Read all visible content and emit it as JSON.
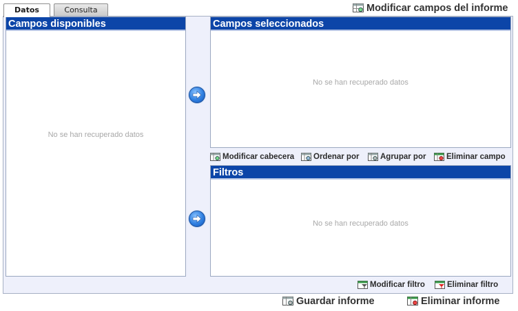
{
  "tabs": [
    {
      "label": "Datos",
      "active": true
    },
    {
      "label": "Consulta",
      "active": false
    }
  ],
  "top_action": {
    "label": "Modificar campos del informe",
    "icon": "table-edit-icon"
  },
  "available_fields": {
    "title": "Campos disponibles",
    "empty_text": "No se han recuperado datos"
  },
  "selected_fields": {
    "title": "Campos seleccionados",
    "empty_text": "No se han recuperado datos",
    "actions": [
      {
        "label": "Modificar cabecera",
        "icon": "table-edit-icon"
      },
      {
        "label": "Ordenar por",
        "icon": "table-sort-icon"
      },
      {
        "label": "Agrupar por",
        "icon": "table-group-icon"
      },
      {
        "label": "Eliminar campo",
        "icon": "table-delete-icon"
      }
    ]
  },
  "filters": {
    "title": "Filtros",
    "empty_text": "No se han recuperado datos",
    "actions": [
      {
        "label": "Modificar filtro",
        "icon": "filter-edit-icon"
      },
      {
        "label": "Eliminar filtro",
        "icon": "filter-delete-icon"
      }
    ]
  },
  "bottom_actions": [
    {
      "label": "Guardar informe",
      "icon": "table-save-icon"
    },
    {
      "label": "Eliminar informe",
      "icon": "table-delete-icon"
    }
  ],
  "colors": {
    "header": "#0c45a8",
    "frame_bg": "#eef0fb",
    "empty_text": "#a8a8a8"
  }
}
